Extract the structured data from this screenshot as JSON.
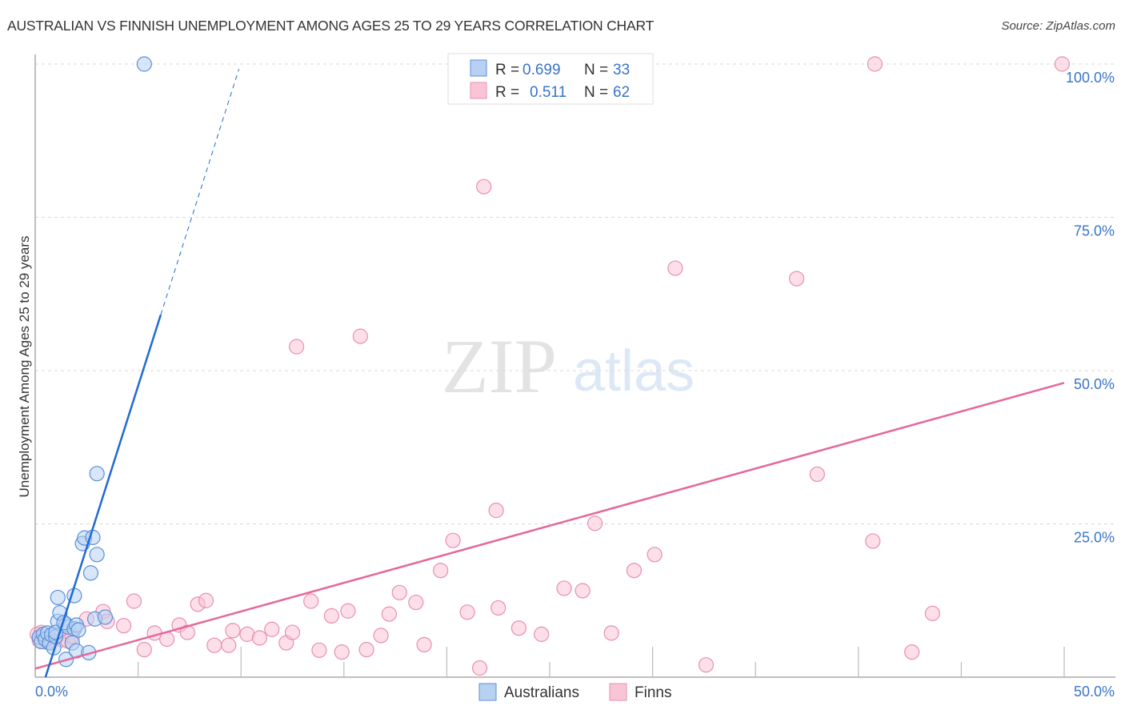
{
  "title": "AUSTRALIAN VS FINNISH UNEMPLOYMENT AMONG AGES 25 TO 29 YEARS CORRELATION CHART",
  "source": "Source: ZipAtlas.com",
  "watermark": {
    "zip": "ZIP",
    "atlas": "atlas"
  },
  "colors": {
    "australians_fill": "#b7d1f3",
    "australians_stroke": "#5b8fd9",
    "australians_line": "#1f6ad4",
    "finns_fill": "#f9c5d6",
    "finns_stroke": "#e98fae",
    "finns_line": "#e4689a",
    "axis_label": "#3a74c9"
  },
  "stats_legend": [
    {
      "series": "Australians",
      "r_label": "R =",
      "r_value": "0.699",
      "n_label": "N =",
      "n_value": "33"
    },
    {
      "series": "Finns",
      "r_label": "R =",
      "r_value": "0.511",
      "n_label": "N =",
      "n_value": "62"
    }
  ],
  "chart_data": {
    "type": "scatter",
    "title": "AUSTRALIAN VS FINNISH UNEMPLOYMENT AMONG AGES 25 TO 29 YEARS CORRELATION CHART",
    "xlabel": "",
    "ylabel": "Unemployment Among Ages 25 to 29 years",
    "xlim": [
      0,
      50
    ],
    "ylim": [
      0,
      100
    ],
    "x_tick_labels": [
      {
        "value": 0,
        "label": "0.0%"
      },
      {
        "value": 50,
        "label": "50.0%"
      }
    ],
    "y_tick_labels": [
      {
        "value": 25,
        "label": "25.0%"
      },
      {
        "value": 50,
        "label": "50.0%"
      },
      {
        "value": 75,
        "label": "75.0%"
      },
      {
        "value": 100,
        "label": "100.0%"
      }
    ],
    "x_minor_ticks": [
      5,
      10,
      15,
      20,
      25,
      30,
      35,
      40,
      45,
      50
    ],
    "grid": "horizontal dashed",
    "legend": "bottom-center",
    "series": [
      {
        "name": "Australians",
        "r": 0.699,
        "n": 33,
        "points": [
          [
            0.2,
            6.5
          ],
          [
            0.3,
            5.8
          ],
          [
            0.4,
            7.0
          ],
          [
            0.5,
            6.2
          ],
          [
            0.6,
            7.2
          ],
          [
            0.7,
            5.6
          ],
          [
            0.8,
            6.9
          ],
          [
            0.9,
            4.8
          ],
          [
            1.0,
            6.6
          ],
          [
            1.1,
            9.1
          ],
          [
            1.0,
            7.3
          ],
          [
            1.1,
            13.0
          ],
          [
            1.2,
            10.5
          ],
          [
            1.5,
            8.6
          ],
          [
            1.6,
            8.2
          ],
          [
            1.4,
            8.9
          ],
          [
            1.5,
            2.9
          ],
          [
            1.8,
            5.6
          ],
          [
            1.9,
            7.9
          ],
          [
            1.9,
            13.3
          ],
          [
            2.0,
            8.5
          ],
          [
            2.0,
            4.3
          ],
          [
            2.1,
            7.7
          ],
          [
            2.3,
            21.8
          ],
          [
            2.4,
            22.7
          ],
          [
            2.6,
            4.0
          ],
          [
            2.7,
            17.0
          ],
          [
            2.8,
            22.8
          ],
          [
            3.0,
            20.0
          ],
          [
            2.9,
            9.5
          ],
          [
            3.4,
            9.8
          ],
          [
            3.0,
            33.2
          ],
          [
            5.3,
            100.0
          ]
        ],
        "trendline": {
          "x": [
            0.5,
            6.1
          ],
          "y": [
            0.0,
            59.1
          ],
          "extrapolated_to": [
            9.9,
            99.2
          ]
        }
      },
      {
        "name": "Finns",
        "r": 0.511,
        "n": 62,
        "points": [
          [
            0.1,
            7.0
          ],
          [
            0.2,
            6.0
          ],
          [
            0.3,
            7.3
          ],
          [
            0.6,
            5.7
          ],
          [
            0.8,
            6.0
          ],
          [
            1.3,
            6.1
          ],
          [
            1.6,
            5.9
          ],
          [
            1.8,
            6.6
          ],
          [
            2.5,
            9.5
          ],
          [
            3.3,
            10.7
          ],
          [
            3.5,
            9.1
          ],
          [
            4.3,
            8.4
          ],
          [
            4.8,
            12.4
          ],
          [
            5.3,
            4.5
          ],
          [
            5.8,
            7.2
          ],
          [
            6.4,
            6.2
          ],
          [
            7.0,
            8.5
          ],
          [
            7.4,
            7.3
          ],
          [
            7.9,
            11.9
          ],
          [
            8.3,
            12.5
          ],
          [
            8.7,
            5.2
          ],
          [
            9.4,
            5.2
          ],
          [
            9.6,
            7.6
          ],
          [
            10.3,
            7.0
          ],
          [
            10.9,
            6.4
          ],
          [
            11.5,
            7.8
          ],
          [
            12.2,
            5.6
          ],
          [
            12.5,
            7.3
          ],
          [
            12.7,
            53.9
          ],
          [
            13.4,
            12.4
          ],
          [
            13.8,
            4.4
          ],
          [
            14.4,
            10.0
          ],
          [
            14.9,
            4.1
          ],
          [
            15.2,
            10.8
          ],
          [
            15.8,
            55.6
          ],
          [
            16.1,
            4.5
          ],
          [
            16.8,
            6.8
          ],
          [
            17.2,
            10.3
          ],
          [
            17.7,
            13.8
          ],
          [
            18.5,
            12.2
          ],
          [
            18.9,
            5.3
          ],
          [
            19.7,
            17.4
          ],
          [
            20.3,
            22.3
          ],
          [
            21.0,
            10.6
          ],
          [
            21.6,
            1.5
          ],
          [
            22.4,
            27.2
          ],
          [
            21.8,
            80.0
          ],
          [
            22.5,
            11.3
          ],
          [
            23.5,
            8.0
          ],
          [
            24.6,
            7.0
          ],
          [
            25.7,
            14.5
          ],
          [
            26.6,
            14.1
          ],
          [
            27.2,
            25.1
          ],
          [
            28.0,
            7.2
          ],
          [
            29.1,
            17.4
          ],
          [
            30.1,
            20.0
          ],
          [
            31.1,
            66.7
          ],
          [
            32.6,
            2.0
          ],
          [
            37.0,
            65.0
          ],
          [
            38.0,
            33.1
          ],
          [
            40.8,
            100.0
          ],
          [
            40.7,
            22.2
          ],
          [
            42.6,
            4.1
          ],
          [
            43.6,
            10.4
          ],
          [
            49.9,
            100.0
          ]
        ],
        "trendline": {
          "x": [
            0,
            50
          ],
          "y": [
            1.4,
            48.0
          ]
        }
      }
    ]
  },
  "bottom_legend": [
    {
      "label": "Australians"
    },
    {
      "label": "Finns"
    }
  ]
}
